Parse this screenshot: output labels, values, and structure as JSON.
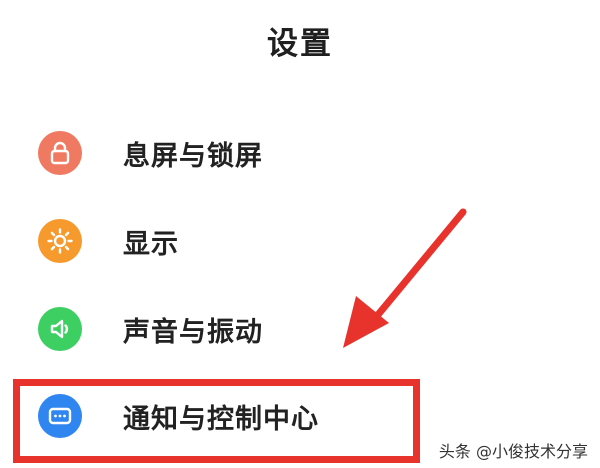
{
  "header": {
    "title": "设置"
  },
  "settings": {
    "items": [
      {
        "label": "息屏与锁屏",
        "icon": "lock-icon",
        "color": "#f07a61"
      },
      {
        "label": "显示",
        "icon": "sun-icon",
        "color": "#f79a2e"
      },
      {
        "label": "声音与振动",
        "icon": "speaker-icon",
        "color": "#3ecf63"
      },
      {
        "label": "通知与控制中心",
        "icon": "notification-icon",
        "color": "#2f86f0"
      }
    ]
  },
  "annotation": {
    "highlight_color": "#e8322c"
  },
  "watermark": {
    "text": "头条 @小俊技术分享"
  }
}
